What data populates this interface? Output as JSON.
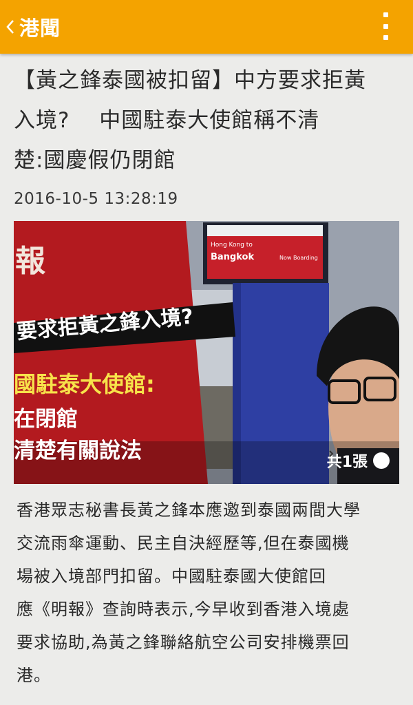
{
  "header": {
    "title": "港聞",
    "back_icon": "chevron-left-icon",
    "menu_icon": "overflow-menu-icon",
    "color": "#f4a300"
  },
  "article": {
    "headline": "【黃之鋒泰國被扣留】中方要求拒黃\n入境?　 中國駐泰大使館稱不清\n楚:國慶假仍閉館",
    "timestamp": "2016-10-5 13:28:19",
    "photo": {
      "banner_left_glyph": "報",
      "banner_question": "要求拒黃之鋒入境?",
      "banner_line1": "國駐泰大使館:",
      "banner_line2": "在閉館",
      "banner_line3": "清楚有關說法",
      "flight_board_line1": "Hong Kong to",
      "flight_board_line2": "Bangkok",
      "flight_board_status": "Now Boarding",
      "counter": "共1張",
      "counter_icon": "chevron-right-circle-icon"
    },
    "body": "香港眾志秘書長黃之鋒本應邀到泰國兩間大學\n交流雨傘運動、民主自決經歷等,但在泰國機\n場被入境部門扣留。中國駐泰國大使館回\n應《明報》查詢時表示,今早收到香港入境處\n要求協助,為黃之鋒聯絡航空公司安排機票回\n港。"
  }
}
